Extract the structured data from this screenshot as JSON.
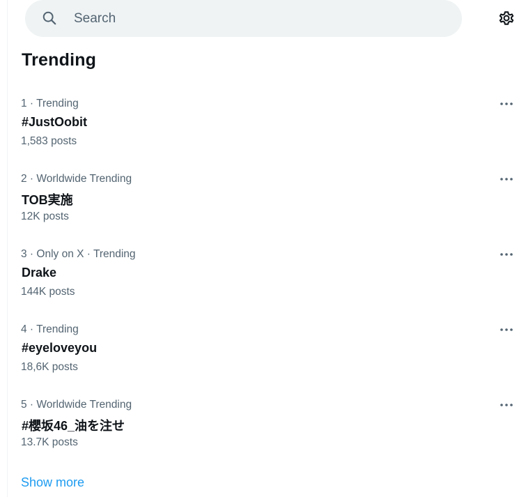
{
  "search": {
    "placeholder": "Search",
    "icon": "search-icon"
  },
  "header": {
    "settings_icon": "gear-icon"
  },
  "trending": {
    "title": "Trending",
    "items": [
      {
        "context": "1 · Trending",
        "name": "#JustOobit",
        "count": "1,583 posts"
      },
      {
        "context": "2 · Worldwide Trending",
        "name": "TOB実施",
        "count": "12K posts"
      },
      {
        "context": "3 · Only on X · Trending",
        "name": "Drake",
        "count": "144K posts"
      },
      {
        "context": "4 · Trending",
        "name": "#eyeloveyou",
        "count": "18,6K posts"
      },
      {
        "context": "5 · Worldwide Trending",
        "name": "#櫻坂46_油を注せ",
        "count": "13.7K posts"
      }
    ],
    "show_more_label": "Show more"
  },
  "colors": {
    "accent": "#1d9bf0",
    "secondary_text": "#536471",
    "primary_text": "#0f1419",
    "search_bg": "#eff3f4"
  }
}
